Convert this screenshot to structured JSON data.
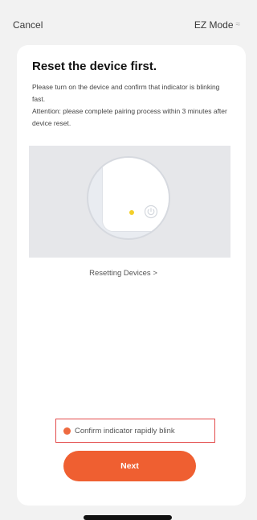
{
  "header": {
    "cancel_label": "Cancel",
    "mode_label": "EZ Mode",
    "mode_icon": "switch-icon"
  },
  "card": {
    "title": "Reset the device first.",
    "instruction": "Please turn on the device and confirm that indicator is blinking fast.",
    "attention": "Attention: please complete pairing process within 3 minutes after device reset.",
    "reset_link_label": "Resetting Devices >",
    "confirm_label": "Confirm indicator rapidly blink",
    "next_label": "Next"
  },
  "colors": {
    "accent": "#ef5f31",
    "confirm_border": "#e34b4b",
    "led": "#f3cf2a"
  }
}
